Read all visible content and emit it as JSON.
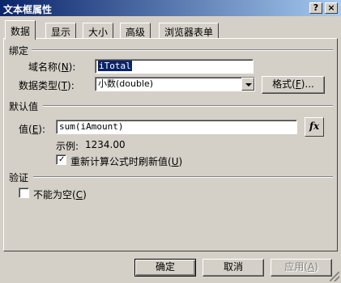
{
  "window": {
    "title": "文本框属性",
    "help_label": "?",
    "close_label": "×"
  },
  "tabs": [
    {
      "label": "数据",
      "active": true
    },
    {
      "label": "显示",
      "active": false
    },
    {
      "label": "大小",
      "active": false
    },
    {
      "label": "高级",
      "active": false
    },
    {
      "label": "浏览器表单",
      "active": false
    }
  ],
  "binding": {
    "group_title": "绑定",
    "domain_name_label": "域名称(",
    "domain_name_key": "N",
    "domain_name_suffix": "):",
    "domain_name_value": "iTotal",
    "data_type_label": "数据类型(",
    "data_type_key": "T",
    "data_type_suffix": "):",
    "data_type_value": "小数(double)",
    "format_button": "格式(",
    "format_key": "F",
    "format_suffix": ")..."
  },
  "default_value": {
    "group_title": "默认值",
    "value_label": "值(",
    "value_key": "E",
    "value_suffix": "):",
    "value": "sum(iAmount)",
    "fx_label": "fx",
    "example_label": "示例:",
    "example_value": "1234.00",
    "recalc_label": "重新计算公式时刷新值(",
    "recalc_key": "U",
    "recalc_suffix": ")",
    "recalc_checked": true
  },
  "validation": {
    "group_title": "验证",
    "not_empty_label": "不能为空(",
    "not_empty_key": "C",
    "not_empty_suffix": ")",
    "not_empty_checked": false
  },
  "footer": {
    "ok_label": "确定",
    "cancel_label": "取消",
    "apply_label": "应用(",
    "apply_key": "A",
    "apply_suffix": ")"
  }
}
